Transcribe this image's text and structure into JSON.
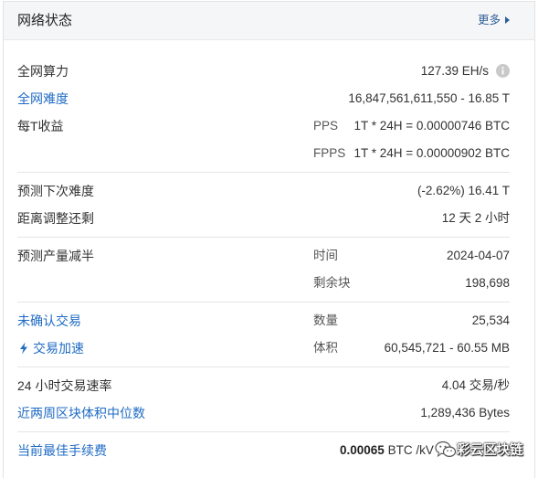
{
  "header": {
    "title": "网络状态",
    "more": "更多"
  },
  "hashrate": {
    "label": "全网算力",
    "value": "127.39 EH/s"
  },
  "difficulty": {
    "label": "全网难度",
    "value": "16,847,561,611,550 - 16.85 T"
  },
  "earnings": {
    "label": "每T收益",
    "pps": {
      "label": "PPS",
      "value": "1T * 24H = 0.00000746 BTC"
    },
    "fpps": {
      "label": "FPPS",
      "value": "1T * 24H = 0.00000902 BTC"
    }
  },
  "next_difficulty": {
    "label": "预测下次难度",
    "value": "(-2.62%) 16.41 T"
  },
  "adjustment_remaining": {
    "label": "距离调整还剩",
    "value": "12 天 2 小时"
  },
  "halving": {
    "label": "预测产量减半",
    "time": {
      "label": "时间",
      "value": "2024-04-07"
    },
    "blocks": {
      "label": "剩余块",
      "value": "198,698"
    }
  },
  "unconfirmed": {
    "label": "未确认交易",
    "count": {
      "label": "数量",
      "value": "25,534"
    }
  },
  "accelerate": {
    "label": "交易加速",
    "size": {
      "label": "体积",
      "value": "60,545,721 - 60.55 MB"
    }
  },
  "tx_rate": {
    "label": "24 小时交易速率",
    "value": "4.04 交易/秒"
  },
  "median_block_size": {
    "label": "近两周区块体积中位数",
    "value": "1,289,436 Bytes"
  },
  "best_fee": {
    "label": "当前最佳手续费",
    "amount": "0.00065",
    "unit": "BTC /kV"
  },
  "watermark": {
    "text": "彩云区块链",
    "icon": "wechat-logo-icon"
  },
  "icons": {
    "info": "info-icon",
    "accelerate": "lightning-icon",
    "more": "caret-right-icon"
  },
  "colors": {
    "link": "#1f6bc4",
    "more_link": "#2f5f96",
    "text": "#333333",
    "muted": "#555555",
    "divider": "#e6e6e6",
    "header_bg": "#f5f6f8",
    "info_icon": "#c9c9c9"
  }
}
